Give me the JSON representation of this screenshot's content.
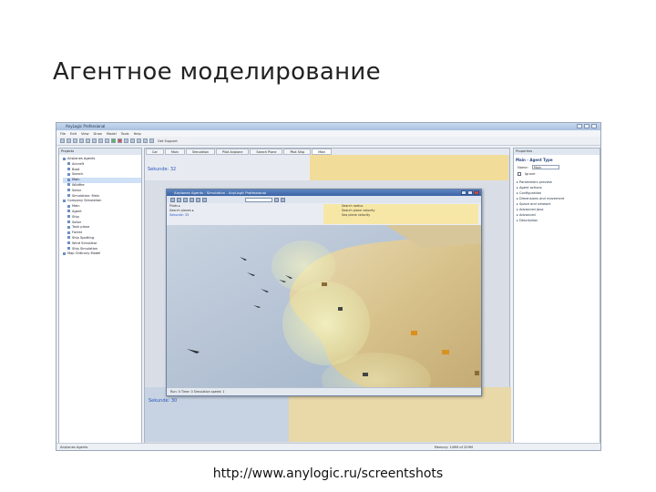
{
  "slide": {
    "title": "Агентное моделирование",
    "url": "http://www.anylogic.ru/screentshots"
  },
  "app": {
    "title": "AnyLogic Professional",
    "menu": [
      "File",
      "Edit",
      "View",
      "Draw",
      "Model",
      "Tools",
      "Help"
    ],
    "toolbar_label": "Get Support",
    "editor_tabs": [
      "Car",
      "Main",
      "Simulation",
      "Pilot Airplane",
      "Search Plane",
      "Pilot Ship",
      "Main"
    ],
    "tree_header": "Projects",
    "tree_items": [
      "Airplanes Agents",
      "Aircraft",
      "Boat",
      "Search",
      "Main",
      "Wildfire",
      "Sailor",
      "Simulation: Main",
      "Company Simulation",
      "Main",
      "Agent",
      "Ship",
      "Sailor",
      "Tank plane",
      "Forest",
      "Ship Spotting",
      "Wind Simulator",
      "Ship Simulation",
      "Map Ordinary Model"
    ],
    "props_header": "Properties",
    "props_title": "Main - Agent Type",
    "props_name_label": "Name:",
    "props_name_value": "Main",
    "props_ignore_label": "Ignore",
    "props_sections": [
      "Parameters preview",
      "Agent actions",
      "Configuration",
      "Dimensions and movement",
      "Space and network",
      "Advanced Java",
      "Advanced",
      "Description"
    ],
    "status_left": "Airplanes Agents",
    "status_right": "Memory: 149M of 209M"
  },
  "background": {
    "time_top": "Sekunde: 32",
    "time_lower": "Sekunde: 30"
  },
  "sim_window": {
    "title": "Airplanes Agents : Simulation - AnyLogic Professional",
    "time": "Sekunde: 33",
    "left_params": [
      "Pilots  ▸",
      "Search planes  ▸",
      "Area size  ▸"
    ],
    "right_params": [
      "Search radius",
      "Search plane velocity",
      "Sea plane velocity"
    ],
    "status": "Run: 0  Time: 0   Simulation speed: 1"
  }
}
